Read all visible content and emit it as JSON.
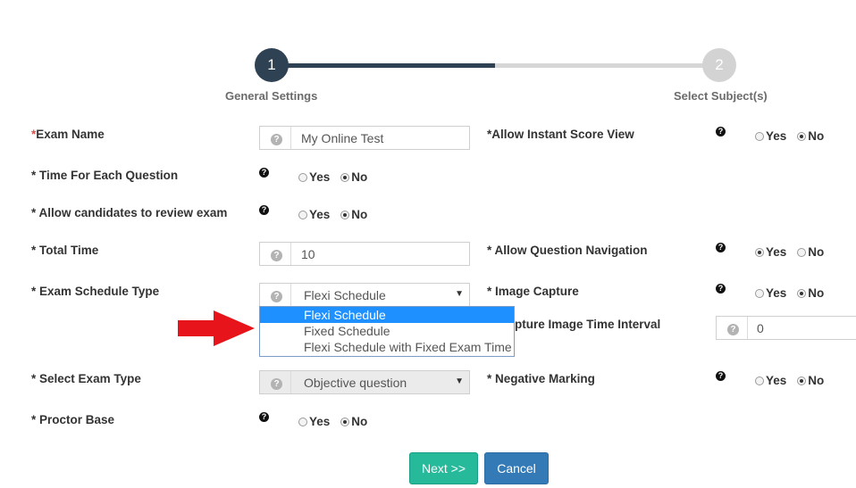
{
  "wizard": {
    "steps": [
      {
        "number": "1",
        "label": "General Settings"
      },
      {
        "number": "2",
        "label": "Select Subject(s)"
      }
    ]
  },
  "form": {
    "exam_name": {
      "label": "Exam Name",
      "value": "My Online Test"
    },
    "time_each_question": {
      "label": "Time For Each Question",
      "selected": "No"
    },
    "allow_review": {
      "label": "Allow candidates to review exam",
      "selected": "No"
    },
    "total_time": {
      "label": "Total Time",
      "value": "10"
    },
    "exam_schedule_type": {
      "label": "Exam Schedule Type",
      "value": "Flexi Schedule",
      "options": [
        "Flexi Schedule",
        "Fixed Schedule",
        "Flexi Schedule with Fixed Exam Time"
      ],
      "highlighted": "Flexi Schedule"
    },
    "select_exam_type": {
      "label": "Select Exam Type",
      "value": "Objective question"
    },
    "proctor_base": {
      "label": "Proctor Base",
      "selected": "No"
    },
    "allow_instant_score": {
      "label": "Allow Instant Score View",
      "selected": "No"
    },
    "allow_question_nav": {
      "label": "Allow Question Navigation",
      "selected": "Yes"
    },
    "image_capture": {
      "label": "Image Capture",
      "selected": "No"
    },
    "capture_interval": {
      "label": "pture Image Time Interval",
      "value": "0"
    },
    "negative_marking": {
      "label": "Negative Marking",
      "selected": "No"
    },
    "radio_yes": "Yes",
    "radio_no": "No",
    "required_mark": "*",
    "help_glyph": "?"
  },
  "actions": {
    "next_label": "Next >>",
    "cancel_label": "Cancel"
  },
  "colors": {
    "step_active": "#2f4254",
    "next_button": "#26b99a",
    "cancel_button": "#337ab7",
    "dropdown_highlight": "#1e90ff",
    "arrow": "#e8141b"
  },
  "icons": {
    "help": "question-circle-icon",
    "arrow": "red-pointer-arrow"
  }
}
